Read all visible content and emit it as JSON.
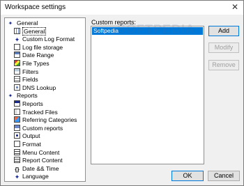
{
  "window": {
    "title": "Workspace settings",
    "close_glyph": "✕"
  },
  "tree": {
    "items": [
      {
        "label": "General",
        "icon": "gear-icon",
        "level": 0
      },
      {
        "label": "General",
        "icon": "grid-icon",
        "level": 1,
        "selected": true
      },
      {
        "label": "Custom Log Format",
        "icon": "star-icon",
        "level": 1
      },
      {
        "label": "Log file storage",
        "icon": "document-icon",
        "level": 1
      },
      {
        "label": "Date Range",
        "icon": "table-icon",
        "level": 1
      },
      {
        "label": "File Types",
        "icon": "palette-icon",
        "level": 1
      },
      {
        "label": "Filters",
        "icon": "filter-icon",
        "level": 1
      },
      {
        "label": "Fields",
        "icon": "fields-icon",
        "level": 1
      },
      {
        "label": "DNS Lookup",
        "icon": "dns-icon",
        "level": 1
      },
      {
        "label": "Reports",
        "icon": "gear-icon",
        "level": 0
      },
      {
        "label": "Reports",
        "icon": "report-icon",
        "level": 1
      },
      {
        "label": "Tracked Files",
        "icon": "tracked-files-icon",
        "level": 1
      },
      {
        "label": "Referring Categories",
        "icon": "referring-icon",
        "level": 1
      },
      {
        "label": "Custom reports",
        "icon": "custom-reports-icon",
        "level": 1
      },
      {
        "label": "Output",
        "icon": "output-icon",
        "level": 1
      },
      {
        "label": "Format",
        "icon": "format-icon",
        "level": 1
      },
      {
        "label": "Menu Content",
        "icon": "menu-content-icon",
        "level": 1
      },
      {
        "label": "Report Content",
        "icon": "report-content-icon",
        "level": 1
      },
      {
        "label": "Date && Time",
        "icon": "braces-icon",
        "level": 1
      },
      {
        "label": "Language",
        "icon": "language-icon",
        "level": 1
      }
    ]
  },
  "custom_reports": {
    "label": "Custom reports:",
    "items": [
      "Softpedia"
    ],
    "watermark": "SOFTPEDIA"
  },
  "buttons": {
    "add": "Add",
    "modify": "Modify",
    "remove": "Remove",
    "ok": "OK",
    "cancel": "Cancel"
  }
}
